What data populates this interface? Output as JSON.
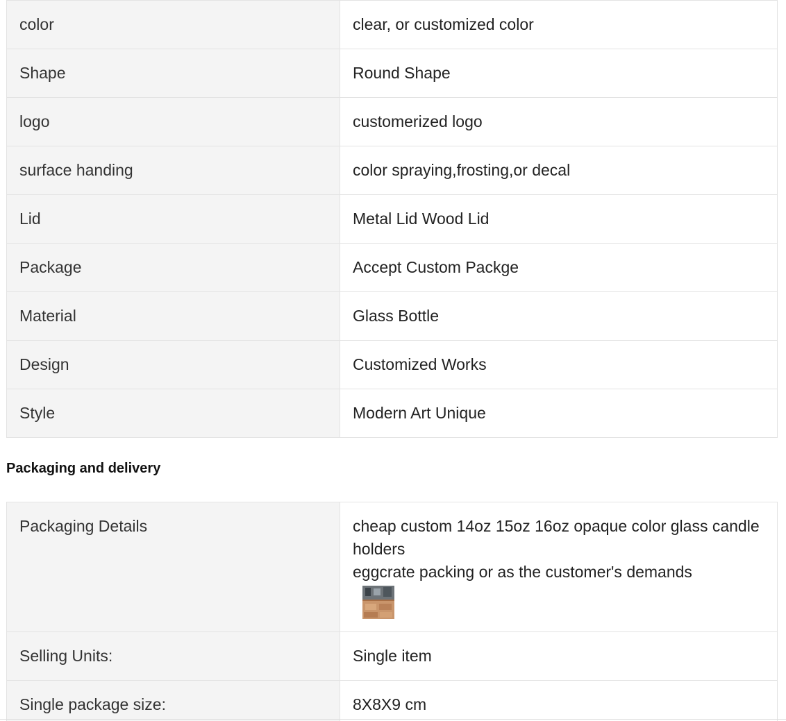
{
  "attributes": [
    {
      "key": "color",
      "value": "clear, or customized color"
    },
    {
      "key": "Shape",
      "value": "Round Shape"
    },
    {
      "key": "logo",
      "value": "customerized logo"
    },
    {
      "key": "surface handing",
      "value": "color spraying,frosting,or decal"
    },
    {
      "key": "Lid",
      "value": "Metal Lid Wood Lid"
    },
    {
      "key": "Package",
      "value": "Accept Custom Packge"
    },
    {
      "key": "Material",
      "value": "Glass Bottle"
    },
    {
      "key": "Design",
      "value": "Customized Works"
    },
    {
      "key": "Style",
      "value": "Modern Art Unique"
    }
  ],
  "packaging": {
    "title": "Packaging and delivery",
    "details_key": "Packaging Details",
    "details_line1": "cheap custom 14oz 15oz 16oz opaque color glass candle holders",
    "details_line2": "eggcrate packing or as the customer's demands",
    "rows": [
      {
        "key": "Selling Units:",
        "value": "Single item"
      },
      {
        "key": "Single package size:",
        "value": "8X8X9 cm"
      }
    ]
  }
}
